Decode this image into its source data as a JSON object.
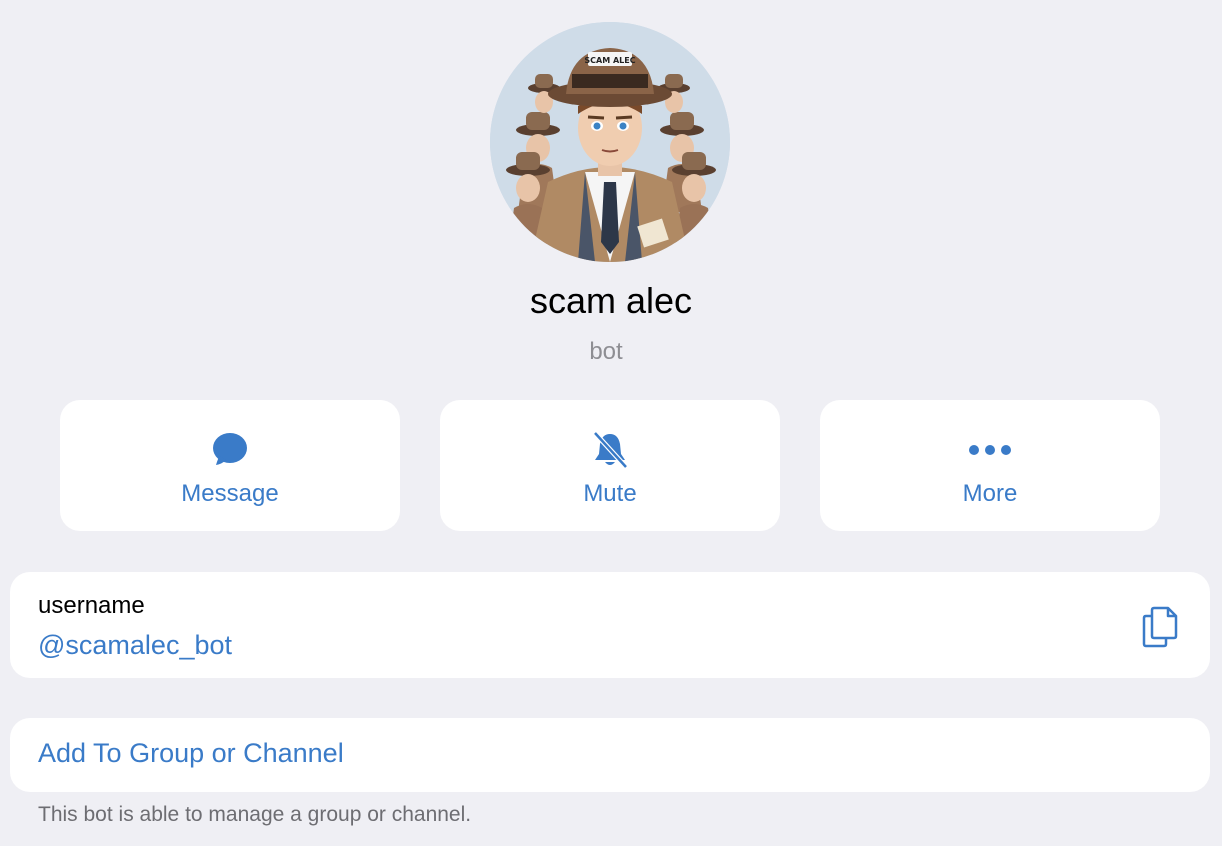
{
  "profile": {
    "name": "scam alec",
    "status": "bot",
    "hat_band_text": "SCAM ALEC"
  },
  "actions": [
    {
      "label": "Message",
      "icon": "message-bubble-icon"
    },
    {
      "label": "Mute",
      "icon": "bell-slash-icon"
    },
    {
      "label": "More",
      "icon": "ellipsis-icon"
    }
  ],
  "username": {
    "label": "username",
    "value": "@scamalec_bot",
    "icon": "copy-icon"
  },
  "add_to_group": {
    "label": "Add To Group or Channel",
    "note": "This bot is able to manage a group or channel."
  },
  "colors": {
    "background": "#efeff4",
    "accent": "#3a7bc8",
    "card": "#ffffff",
    "secondary_text": "#8e8e93"
  }
}
